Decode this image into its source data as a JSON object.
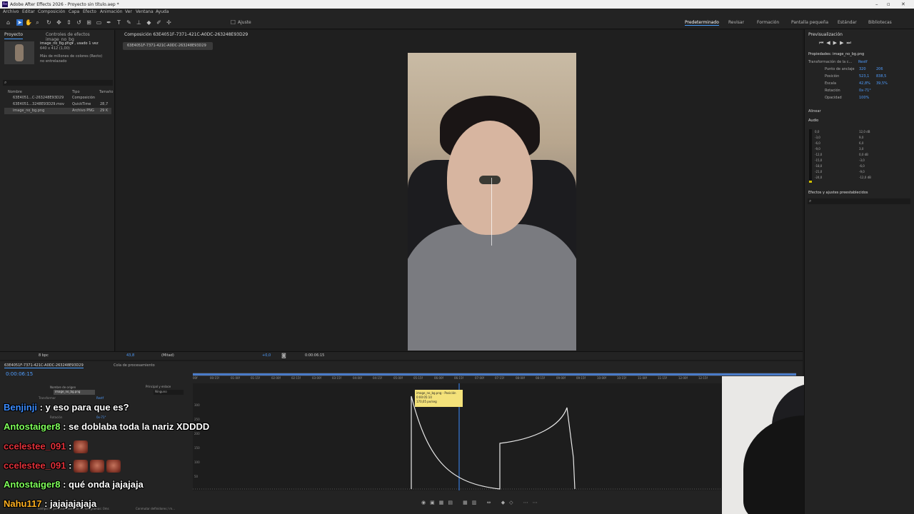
{
  "window": {
    "title": "Adobe After Effects 2026 - Proyecto sin título.aep *"
  },
  "menu": [
    "Archivo",
    "Editar",
    "Composición",
    "Capa",
    "Efecto",
    "Animación",
    "Ver",
    "Ventana",
    "Ayuda"
  ],
  "toolbar": {
    "snap_label": "Ajuste"
  },
  "workspaces": [
    "Predeterminado",
    "Revisar",
    "Formación",
    "Pantalla pequeña",
    "Estándar",
    "Bibliotecas"
  ],
  "project": {
    "tab_project": "Proyecto",
    "tab_effects": "Controles de efectos image_no_bg",
    "preview_name": "image_no_bg.png▾ , usado 1 vez",
    "preview_dims": "640 x 412 (1,00)",
    "preview_desc1": "Más de millones de colores (Recto)",
    "preview_desc2": "no entrelazado",
    "col_name": "Nombre",
    "col_type": "Tipo",
    "col_size": "Tamaño",
    "files": [
      {
        "name": "63E4051...C-263248E93D29",
        "type": "Composición",
        "size": ""
      },
      {
        "name": "63E4051...3248E93D29.mov",
        "type": "QuickTime",
        "size": "28,7"
      },
      {
        "name": "image_no_bg.png",
        "type": "Archivo PNG",
        "size": "29 K"
      }
    ],
    "bpc": "8 bpc"
  },
  "composition": {
    "tab": "Composición 63E4051F-7371-421C-A0DC-263248E93D29",
    "breadcrumb": "63E4051F-7371-421C-A0DC-263248E93D29",
    "zoom": "43,8",
    "resolution": "(Mitad)",
    "exposure": "+0,0",
    "timecode": "0:00:06:15"
  },
  "timeline": {
    "tab": "63E4051F-7371-421C-A0DC-263248E93D29",
    "tab_render": "Cola de procesamiento",
    "timecode": "0:00:06:15",
    "col_source": "Nombre de origen",
    "col_parent": "Principal y enlace",
    "layer_name": "image_no_bg.png",
    "parent_value": "Ninguno",
    "transform_label": "Transformar",
    "reset_label": "Restf",
    "rotation_label": "Rotación",
    "rotation_value": "0x-71°",
    "footer_left": "Tiempo de procesamiento de los fotogramas: 0ms",
    "footer_mid": "Conmutar definidores / m...",
    "ticks": [
      "00f",
      "00:15f",
      "01:00f",
      "01:15f",
      "02:00f",
      "02:15f",
      "03:00f",
      "03:15f",
      "04:00f",
      "04:15f",
      "05:00f",
      "05:15f",
      "06:00f",
      "06:15f",
      "07:00f",
      "07:15f",
      "08:00f",
      "08:15f",
      "09:00f",
      "09:15f",
      "10:00f",
      "10:15f",
      "11:00f",
      "11:15f",
      "12:00f",
      "12:15f"
    ],
    "graph_yticks": [
      "350",
      "300",
      "250",
      "200",
      "150",
      "100",
      "50",
      "0"
    ],
    "tooltip": {
      "line1": "image_no_bg.png - Posición",
      "line2": "0:00:05:10",
      "line3": "170,05 px/seg"
    }
  },
  "right_panel": {
    "preview_title": "Previsualización",
    "props_title": "Propiedades: image_no_bg.png",
    "transform_title": "Transformación de la c...",
    "reset": "Restf",
    "props": [
      {
        "label": "Punto de anclaje",
        "v1": "320",
        "v2": "206"
      },
      {
        "label": "Posición",
        "v1": "523,1",
        "v2": "838,5"
      },
      {
        "label": "Escala",
        "v1": "42,8%",
        "v2": "39,5%"
      },
      {
        "label": "Rotación",
        "v1": "0x-71°",
        "v2": ""
      },
      {
        "label": "Opacidad",
        "v1": "100%",
        "v2": ""
      }
    ],
    "align_title": "Alinear",
    "audio_title": "Audio",
    "audio_left": [
      "0,0",
      "-3,0",
      "-6,0",
      "-9,0",
      "-12,0",
      "-15,0",
      "-18,0",
      "-21,0",
      "-24,0"
    ],
    "audio_right": [
      "12,0 dB",
      "9,0",
      "6,0",
      "3,0",
      "0,0 dB",
      "-3,0",
      "-6,0",
      "-9,0",
      "-12,0 dB"
    ],
    "effects_title": "Efectos y ajustes preestablecidos"
  },
  "chat": [
    {
      "user": "Benjinji",
      "message": ": y eso para que es?",
      "color": "#3b8cff",
      "emotes": 0
    },
    {
      "user": "Antostaiger8",
      "message": ": se doblaba toda la nariz XDDDD",
      "color": "#7fff5a",
      "emotes": 0
    },
    {
      "user": "ccelestee_091",
      "message": ":",
      "color": "#e0313a",
      "emotes": 1
    },
    {
      "user": "ccelestee_091",
      "message": ":",
      "color": "#e0313a",
      "emotes": 3
    },
    {
      "user": "Antostaiger8",
      "message": ": qué onda jajajaja",
      "color": "#7fff5a",
      "emotes": 0
    },
    {
      "user": "Nahu117",
      "message": ": jajajajajaja",
      "color": "#ffb020",
      "emotes": 0
    }
  ]
}
